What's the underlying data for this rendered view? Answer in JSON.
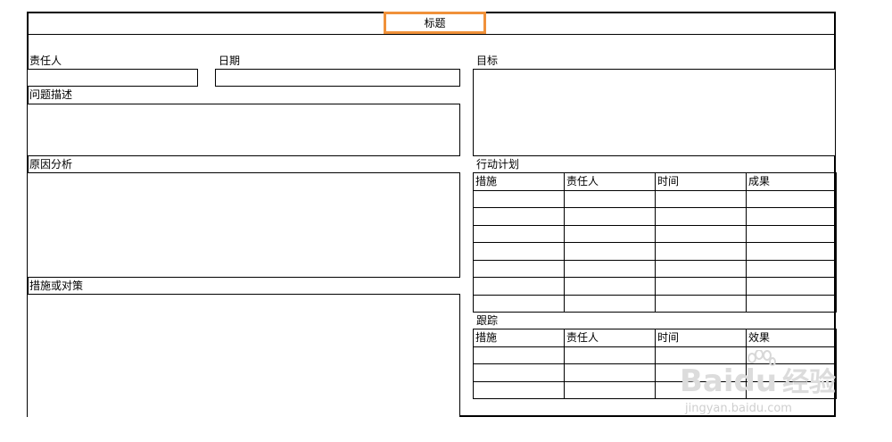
{
  "form": {
    "title": "标题",
    "owner_label": "责任人",
    "date_label": "日期",
    "problem_label": "问题描述",
    "cause_label": "原因分析",
    "measures_label": "措施或对策",
    "goal_label": "目标",
    "action_plan_label": "行动计划",
    "tracking_label": "跟踪"
  },
  "action_plan": {
    "headers": [
      "措施",
      "责任人",
      "时间",
      "成果"
    ]
  },
  "tracking": {
    "headers": [
      "措施",
      "责任人",
      "时间",
      "效果"
    ]
  },
  "watermark": {
    "brand": "Bai",
    "brand_tail": "du",
    "brand_cn": "经验",
    "url": "jingyan.baidu.com"
  }
}
